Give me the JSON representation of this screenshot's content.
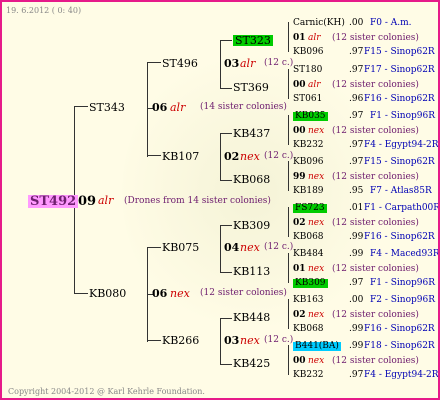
{
  "header": {
    "date": "19.  6.2012 (  0: 40)"
  },
  "footer": {
    "copyright": "Copyright 2004-2012 @ Karl Kehrle Foundation."
  },
  "colors": {
    "frame": "#e61a8a",
    "background": "#fffce6",
    "root_highlight": "#ff99ff",
    "green_highlight": "#00cc00",
    "cyan_highlight": "#00ccff"
  },
  "root": {
    "name": "ST492",
    "gen": "09",
    "race": "alr",
    "note": "(Drones from 14 sister colonies)"
  },
  "level1": [
    {
      "name": "ST343",
      "gen": "06",
      "race": "alr",
      "note": "(14 sister colonies)"
    },
    {
      "name": "KB080",
      "gen": "06",
      "race": "nex",
      "note": "(12 sister colonies)"
    }
  ],
  "level2": [
    {
      "name": "ST496",
      "gen": "03",
      "race": "alr",
      "note": "(12 c.)"
    },
    {
      "name": "KB107",
      "gen": "02",
      "race": "nex",
      "note": "(12 c.)"
    },
    {
      "name": "KB075",
      "gen": "04",
      "race": "nex",
      "note": "(12 c.)"
    },
    {
      "name": "KB266",
      "gen": "03",
      "race": "nex",
      "note": "(12 c.)"
    }
  ],
  "level3": [
    {
      "name": "ST323"
    },
    {
      "name": "ST369"
    },
    {
      "name": "KB437"
    },
    {
      "name": "KB068"
    },
    {
      "name": "KB309"
    },
    {
      "name": "KB113"
    },
    {
      "name": "KB448"
    },
    {
      "name": "KB425"
    }
  ],
  "level4": [
    {
      "name": "Carnic(KH)",
      "year": ".00",
      "info": "F0 - A.m."
    },
    {
      "name": "01",
      "race": "alr",
      "note": "(12 sister colonies)"
    },
    {
      "name": "KB096",
      "year": ".97",
      "info": "F15 - Sinop62R"
    },
    {
      "name": "ST180",
      "year": ".97",
      "info": "F17 - Sinop62R"
    },
    {
      "name": "00",
      "race": "alr",
      "note": "(12 sister colonies)"
    },
    {
      "name": "ST061",
      "year": ".96",
      "info": "F16 - Sinop62R"
    },
    {
      "name": "KB035",
      "year": ".97",
      "info": "F1 - Sinop96R"
    },
    {
      "name": "00",
      "race": "nex",
      "note": "(12 sister colonies)"
    },
    {
      "name": "KB232",
      "year": ".97",
      "info": "F4 - Egypt94-2R"
    },
    {
      "name": "KB096",
      "year": ".97",
      "info": "F15 - Sinop62R"
    },
    {
      "name": "99",
      "race": "nex",
      "note": "(12 sister colonies)"
    },
    {
      "name": "KB189",
      "year": ".95",
      "info": "F7 - Atlas85R"
    },
    {
      "name": "FS723",
      "year": ".01",
      "info": "F1 - Carpath00R"
    },
    {
      "name": "02",
      "race": "nex",
      "note": "(12 sister colonies)"
    },
    {
      "name": "KB068",
      "year": ".99",
      "info": "F16 - Sinop62R"
    },
    {
      "name": "KB484",
      "year": ".99",
      "info": "F4 - Maced93R"
    },
    {
      "name": "01",
      "race": "nex",
      "note": "(12 sister colonies)"
    },
    {
      "name": "KB309",
      "year": ".97",
      "info": "F1 - Sinop96R"
    },
    {
      "name": "KB163",
      "year": ".00",
      "info": "F2 - Sinop96R"
    },
    {
      "name": "02",
      "race": "nex",
      "note": "(12 sister colonies)"
    },
    {
      "name": "KB068",
      "year": ".99",
      "info": "F16 - Sinop62R"
    },
    {
      "name": "B441(BA)",
      "year": ".99",
      "info": "F18 - Sinop62R"
    },
    {
      "name": "00",
      "race": "nex",
      "note": "(12 sister colonies)"
    },
    {
      "name": "KB232",
      "year": ".97",
      "info": "F4 - Egypt94-2R"
    }
  ]
}
